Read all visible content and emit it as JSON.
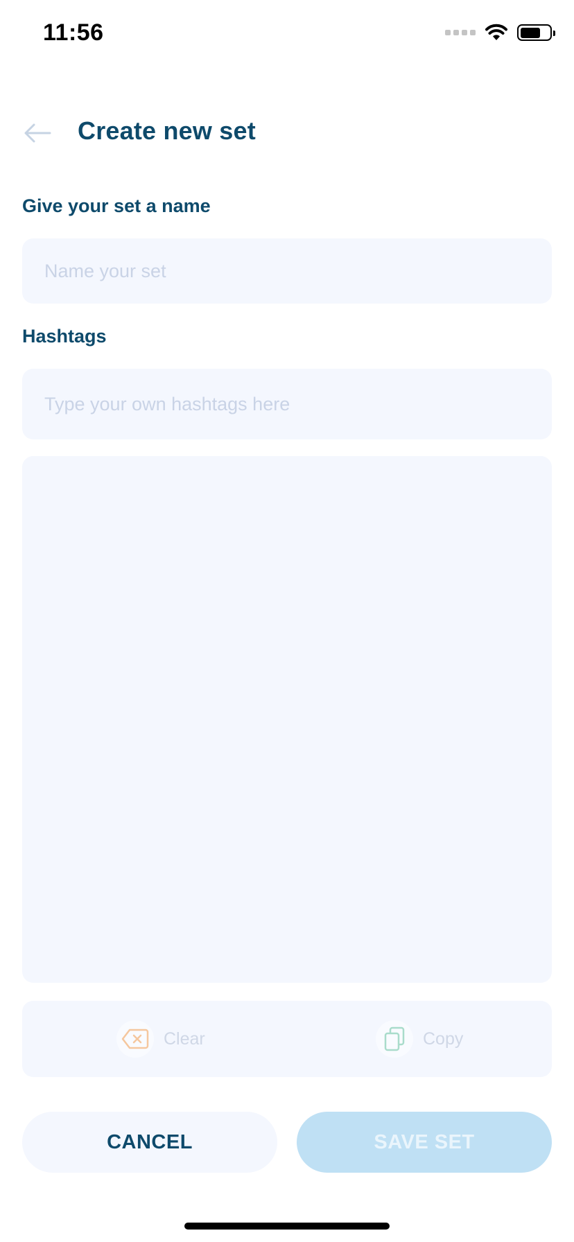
{
  "status_bar": {
    "time": "11:56"
  },
  "header": {
    "title": "Create new set"
  },
  "name_section": {
    "label": "Give your set a name",
    "placeholder": "Name your set"
  },
  "hashtags_section": {
    "label": "Hashtags",
    "placeholder": "Type your own hashtags here"
  },
  "actions": {
    "clear_label": "Clear",
    "copy_label": "Copy"
  },
  "buttons": {
    "cancel_label": "CANCEL",
    "save_label": "SAVE SET"
  },
  "colors": {
    "primary_text": "#0e4a6b",
    "field_background": "#f4f7fe",
    "save_disabled": "#bfe0f4",
    "clear_accent": "#f5c79e",
    "copy_accent": "#a9dccb"
  }
}
